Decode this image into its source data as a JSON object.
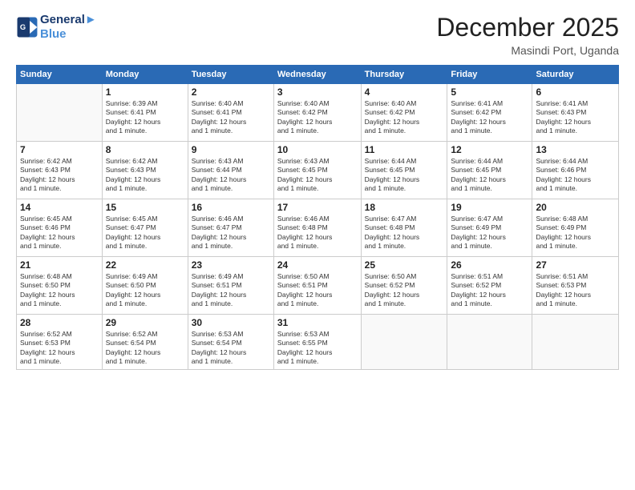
{
  "header": {
    "logo_line1": "General",
    "logo_line2": "Blue",
    "month": "December 2025",
    "location": "Masindi Port, Uganda"
  },
  "weekdays": [
    "Sunday",
    "Monday",
    "Tuesday",
    "Wednesday",
    "Thursday",
    "Friday",
    "Saturday"
  ],
  "weeks": [
    [
      {
        "day": "",
        "info": ""
      },
      {
        "day": "1",
        "info": "Sunrise: 6:39 AM\nSunset: 6:41 PM\nDaylight: 12 hours\nand 1 minute."
      },
      {
        "day": "2",
        "info": "Sunrise: 6:40 AM\nSunset: 6:41 PM\nDaylight: 12 hours\nand 1 minute."
      },
      {
        "day": "3",
        "info": "Sunrise: 6:40 AM\nSunset: 6:42 PM\nDaylight: 12 hours\nand 1 minute."
      },
      {
        "day": "4",
        "info": "Sunrise: 6:40 AM\nSunset: 6:42 PM\nDaylight: 12 hours\nand 1 minute."
      },
      {
        "day": "5",
        "info": "Sunrise: 6:41 AM\nSunset: 6:42 PM\nDaylight: 12 hours\nand 1 minute."
      },
      {
        "day": "6",
        "info": "Sunrise: 6:41 AM\nSunset: 6:43 PM\nDaylight: 12 hours\nand 1 minute."
      }
    ],
    [
      {
        "day": "7",
        "info": "Sunrise: 6:42 AM\nSunset: 6:43 PM\nDaylight: 12 hours\nand 1 minute."
      },
      {
        "day": "8",
        "info": "Sunrise: 6:42 AM\nSunset: 6:43 PM\nDaylight: 12 hours\nand 1 minute."
      },
      {
        "day": "9",
        "info": "Sunrise: 6:43 AM\nSunset: 6:44 PM\nDaylight: 12 hours\nand 1 minute."
      },
      {
        "day": "10",
        "info": "Sunrise: 6:43 AM\nSunset: 6:45 PM\nDaylight: 12 hours\nand 1 minute."
      },
      {
        "day": "11",
        "info": "Sunrise: 6:44 AM\nSunset: 6:45 PM\nDaylight: 12 hours\nand 1 minute."
      },
      {
        "day": "12",
        "info": "Sunrise: 6:44 AM\nSunset: 6:45 PM\nDaylight: 12 hours\nand 1 minute."
      },
      {
        "day": "13",
        "info": "Sunrise: 6:44 AM\nSunset: 6:46 PM\nDaylight: 12 hours\nand 1 minute."
      }
    ],
    [
      {
        "day": "14",
        "info": "Sunrise: 6:45 AM\nSunset: 6:46 PM\nDaylight: 12 hours\nand 1 minute."
      },
      {
        "day": "15",
        "info": "Sunrise: 6:45 AM\nSunset: 6:47 PM\nDaylight: 12 hours\nand 1 minute."
      },
      {
        "day": "16",
        "info": "Sunrise: 6:46 AM\nSunset: 6:47 PM\nDaylight: 12 hours\nand 1 minute."
      },
      {
        "day": "17",
        "info": "Sunrise: 6:46 AM\nSunset: 6:48 PM\nDaylight: 12 hours\nand 1 minute."
      },
      {
        "day": "18",
        "info": "Sunrise: 6:47 AM\nSunset: 6:48 PM\nDaylight: 12 hours\nand 1 minute."
      },
      {
        "day": "19",
        "info": "Sunrise: 6:47 AM\nSunset: 6:49 PM\nDaylight: 12 hours\nand 1 minute."
      },
      {
        "day": "20",
        "info": "Sunrise: 6:48 AM\nSunset: 6:49 PM\nDaylight: 12 hours\nand 1 minute."
      }
    ],
    [
      {
        "day": "21",
        "info": "Sunrise: 6:48 AM\nSunset: 6:50 PM\nDaylight: 12 hours\nand 1 minute."
      },
      {
        "day": "22",
        "info": "Sunrise: 6:49 AM\nSunset: 6:50 PM\nDaylight: 12 hours\nand 1 minute."
      },
      {
        "day": "23",
        "info": "Sunrise: 6:49 AM\nSunset: 6:51 PM\nDaylight: 12 hours\nand 1 minute."
      },
      {
        "day": "24",
        "info": "Sunrise: 6:50 AM\nSunset: 6:51 PM\nDaylight: 12 hours\nand 1 minute."
      },
      {
        "day": "25",
        "info": "Sunrise: 6:50 AM\nSunset: 6:52 PM\nDaylight: 12 hours\nand 1 minute."
      },
      {
        "day": "26",
        "info": "Sunrise: 6:51 AM\nSunset: 6:52 PM\nDaylight: 12 hours\nand 1 minute."
      },
      {
        "day": "27",
        "info": "Sunrise: 6:51 AM\nSunset: 6:53 PM\nDaylight: 12 hours\nand 1 minute."
      }
    ],
    [
      {
        "day": "28",
        "info": "Sunrise: 6:52 AM\nSunset: 6:53 PM\nDaylight: 12 hours\nand 1 minute."
      },
      {
        "day": "29",
        "info": "Sunrise: 6:52 AM\nSunset: 6:54 PM\nDaylight: 12 hours\nand 1 minute."
      },
      {
        "day": "30",
        "info": "Sunrise: 6:53 AM\nSunset: 6:54 PM\nDaylight: 12 hours\nand 1 minute."
      },
      {
        "day": "31",
        "info": "Sunrise: 6:53 AM\nSunset: 6:55 PM\nDaylight: 12 hours\nand 1 minute."
      },
      {
        "day": "",
        "info": ""
      },
      {
        "day": "",
        "info": ""
      },
      {
        "day": "",
        "info": ""
      }
    ]
  ]
}
